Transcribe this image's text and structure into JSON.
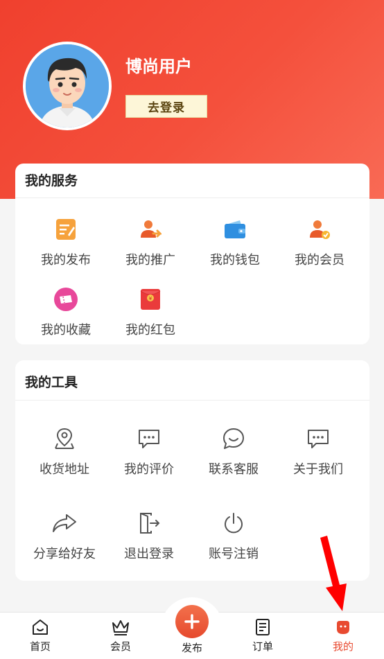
{
  "profile": {
    "username": "博尚用户",
    "login_label": "去登录",
    "avatar_icon": "avatar-icon"
  },
  "services": {
    "title": "我的服务",
    "items": [
      {
        "label": "我的发布",
        "icon": "edit-note-icon"
      },
      {
        "label": "我的推广",
        "icon": "user-share-icon"
      },
      {
        "label": "我的钱包",
        "icon": "wallet-icon"
      },
      {
        "label": "我的会员",
        "icon": "member-badge-icon"
      },
      {
        "label": "我的收藏",
        "icon": "ticket-icon"
      },
      {
        "label": "我的红包",
        "icon": "red-packet-icon"
      }
    ]
  },
  "tools": {
    "title": "我的工具",
    "items": [
      {
        "label": "收货地址",
        "icon": "location-pin-icon"
      },
      {
        "label": "我的评价",
        "icon": "comment-icon"
      },
      {
        "label": "联系客服",
        "icon": "chat-bubble-icon"
      },
      {
        "label": "关于我们",
        "icon": "message-dots-icon"
      },
      {
        "label": "分享给好友",
        "icon": "share-arrow-icon"
      },
      {
        "label": "退出登录",
        "icon": "logout-door-icon"
      },
      {
        "label": "账号注销",
        "icon": "power-icon"
      }
    ]
  },
  "tabbar": {
    "home": "首页",
    "member": "会员",
    "publish": "发布",
    "orders": "订单",
    "mine": "我的"
  },
  "colors": {
    "header_red": "#f0402e",
    "accent": "#e84a30",
    "annotation_arrow": "#ff0000"
  }
}
